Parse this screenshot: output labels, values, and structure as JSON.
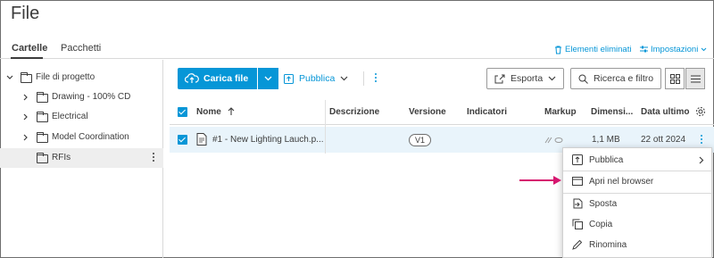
{
  "page": {
    "title": "File"
  },
  "tabs": [
    {
      "label": "Cartelle",
      "active": true
    },
    {
      "label": "Pacchetti",
      "active": false
    }
  ],
  "header_links": {
    "deleted": "Elementi eliminati",
    "settings": "Impostazioni"
  },
  "sidebar": {
    "root": "File di progetto",
    "items": [
      {
        "label": "Drawing - 100% CD"
      },
      {
        "label": "Electrical"
      },
      {
        "label": "Model Coordination"
      },
      {
        "label": "RFIs",
        "selected": true
      }
    ]
  },
  "toolbar": {
    "upload": "Carica file",
    "publish": "Pubblica",
    "export": "Esporta",
    "search": "Ricerca e filtro"
  },
  "table": {
    "columns": [
      "Nome",
      "Descrizione",
      "Versione",
      "Indicatori",
      "Markup",
      "Dimensi...",
      "Data ultimo"
    ],
    "rows": [
      {
        "name": "#1 - New Lighting Lauch.p...",
        "description": "",
        "version": "V1",
        "indicators": "",
        "size": "1,1 MB",
        "date": "22 ott 2024"
      }
    ]
  },
  "context_menu": {
    "items": [
      {
        "label": "Pubblica",
        "icon": "publish-icon",
        "submenu": true
      },
      {
        "label": "Apri nel browser",
        "icon": "browser-icon"
      },
      {
        "label": "Sposta",
        "icon": "move-icon"
      },
      {
        "label": "Copia",
        "icon": "copy-icon"
      },
      {
        "label": "Rinomina",
        "icon": "pencil-icon"
      }
    ]
  },
  "colors": {
    "accent": "#0696d7",
    "row_selected": "#e9f4fb",
    "annotation_arrow": "#d6166f"
  }
}
